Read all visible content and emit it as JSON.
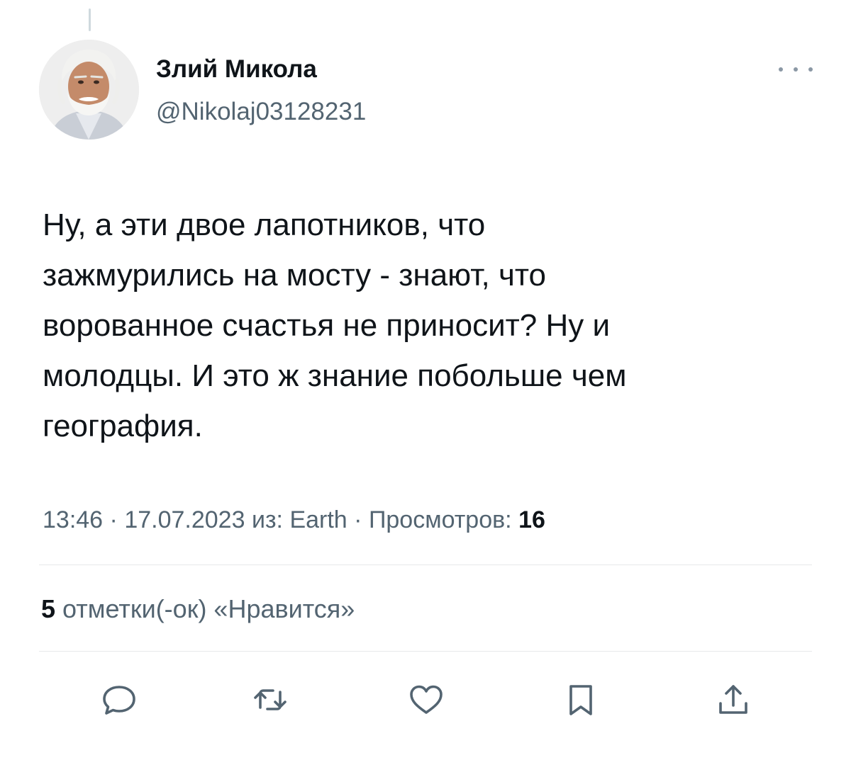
{
  "author": {
    "display_name": "Злий Микола",
    "handle": "@Nikolaj03128231",
    "avatar_icon": "avatar-photo"
  },
  "tweet": {
    "text": "Ну, а эти двое лапотников, что\nзажмурились на мосту - знают, что\nворованное счастья не приносит? Ну и\nмолодцы. И это ж знание побольше чем\nгеография."
  },
  "meta": {
    "time": "13:46",
    "separator": "·",
    "date": "17.07.2023",
    "source_prefix": "из:",
    "source": "Earth",
    "views_label": "Просмотров:",
    "views_count": "16"
  },
  "likes": {
    "count": "5",
    "label": "отметки(-ок) «Нравится»"
  },
  "actions": [
    {
      "name": "reply",
      "icon": "speech-bubble-icon"
    },
    {
      "name": "retweet",
      "icon": "retweet-arrows-icon"
    },
    {
      "name": "like",
      "icon": "heart-icon"
    },
    {
      "name": "bookmark",
      "icon": "bookmark-icon"
    },
    {
      "name": "share",
      "icon": "share-icon"
    }
  ],
  "colors": {
    "text_primary": "#0f1419",
    "text_secondary": "#536471",
    "divider": "#e7e9ea"
  }
}
